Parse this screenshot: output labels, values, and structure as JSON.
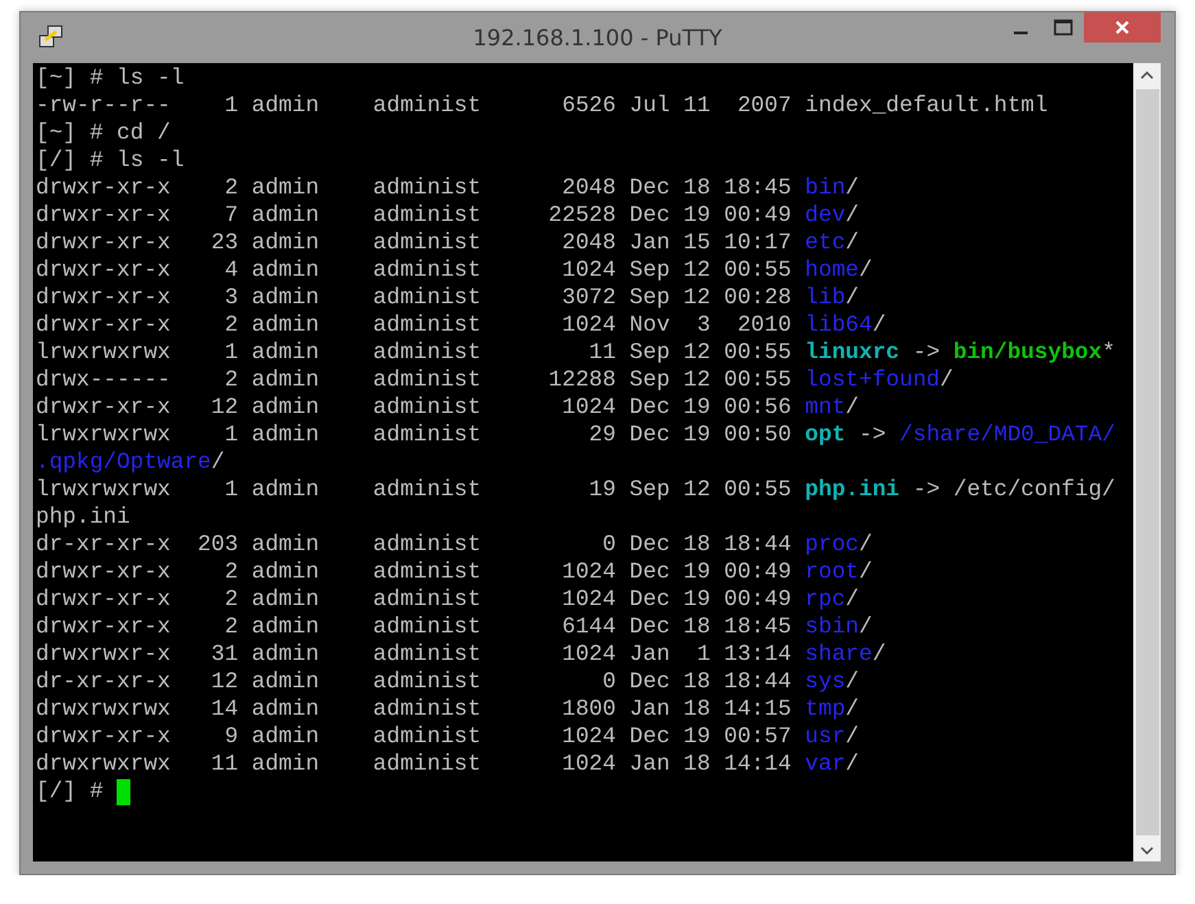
{
  "window": {
    "title": "192.168.1.100 - PuTTY"
  },
  "terminal": {
    "lines": [
      {
        "segments": [
          {
            "text": "[~] # ls -l",
            "kind": "plain"
          }
        ]
      },
      {
        "segments": [
          {
            "text": "-rw-r--r--    1 admin    administ      6526 Jul 11  2007 index_default.html",
            "kind": "plain"
          }
        ]
      },
      {
        "segments": [
          {
            "text": "[~] # cd /",
            "kind": "plain"
          }
        ]
      },
      {
        "segments": [
          {
            "text": "[/] # ls -l",
            "kind": "plain"
          }
        ]
      },
      {
        "segments": [
          {
            "text": "drwxr-xr-x    2 admin    administ      2048 Dec 18 18:45 ",
            "kind": "plain"
          },
          {
            "text": "bin",
            "kind": "dir"
          },
          {
            "text": "/",
            "kind": "plain"
          }
        ]
      },
      {
        "segments": [
          {
            "text": "drwxr-xr-x    7 admin    administ     22528 Dec 19 00:49 ",
            "kind": "plain"
          },
          {
            "text": "dev",
            "kind": "dir"
          },
          {
            "text": "/",
            "kind": "plain"
          }
        ]
      },
      {
        "segments": [
          {
            "text": "drwxr-xr-x   23 admin    administ      2048 Jan 15 10:17 ",
            "kind": "plain"
          },
          {
            "text": "etc",
            "kind": "dir"
          },
          {
            "text": "/",
            "kind": "plain"
          }
        ]
      },
      {
        "segments": [
          {
            "text": "drwxr-xr-x    4 admin    administ      1024 Sep 12 00:55 ",
            "kind": "plain"
          },
          {
            "text": "home",
            "kind": "dir"
          },
          {
            "text": "/",
            "kind": "plain"
          }
        ]
      },
      {
        "segments": [
          {
            "text": "drwxr-xr-x    3 admin    administ      3072 Sep 12 00:28 ",
            "kind": "plain"
          },
          {
            "text": "lib",
            "kind": "dir"
          },
          {
            "text": "/",
            "kind": "plain"
          }
        ]
      },
      {
        "segments": [
          {
            "text": "drwxr-xr-x    2 admin    administ      1024 Nov  3  2010 ",
            "kind": "plain"
          },
          {
            "text": "lib64",
            "kind": "dir"
          },
          {
            "text": "/",
            "kind": "plain"
          }
        ]
      },
      {
        "segments": [
          {
            "text": "lrwxrwxrwx    1 admin    administ        11 Sep 12 00:55 ",
            "kind": "plain"
          },
          {
            "text": "linuxrc",
            "kind": "link"
          },
          {
            "text": " -> ",
            "kind": "plain"
          },
          {
            "text": "bin/busybox",
            "kind": "exec"
          },
          {
            "text": "*",
            "kind": "plain"
          }
        ]
      },
      {
        "segments": [
          {
            "text": "drwx------    2 admin    administ     12288 Sep 12 00:55 ",
            "kind": "plain"
          },
          {
            "text": "lost+found",
            "kind": "dir"
          },
          {
            "text": "/",
            "kind": "plain"
          }
        ]
      },
      {
        "segments": [
          {
            "text": "drwxr-xr-x   12 admin    administ      1024 Dec 19 00:56 ",
            "kind": "plain"
          },
          {
            "text": "mnt",
            "kind": "dir"
          },
          {
            "text": "/",
            "kind": "plain"
          }
        ]
      },
      {
        "segments": [
          {
            "text": "lrwxrwxrwx    1 admin    administ        29 Dec 19 00:50 ",
            "kind": "plain"
          },
          {
            "text": "opt",
            "kind": "link"
          },
          {
            "text": " -> ",
            "kind": "plain"
          },
          {
            "text": "/share/MD0_DATA/",
            "kind": "dir"
          }
        ]
      },
      {
        "segments": [
          {
            "text": ".qpkg/Optware",
            "kind": "dir"
          },
          {
            "text": "/",
            "kind": "plain"
          }
        ]
      },
      {
        "segments": [
          {
            "text": "lrwxrwxrwx    1 admin    administ        19 Sep 12 00:55 ",
            "kind": "plain"
          },
          {
            "text": "php.ini",
            "kind": "link"
          },
          {
            "text": " -> /etc/config/",
            "kind": "plain"
          }
        ]
      },
      {
        "segments": [
          {
            "text": "php.ini",
            "kind": "plain"
          }
        ]
      },
      {
        "segments": [
          {
            "text": "dr-xr-xr-x  203 admin    administ         0 Dec 18 18:44 ",
            "kind": "plain"
          },
          {
            "text": "proc",
            "kind": "dir"
          },
          {
            "text": "/",
            "kind": "plain"
          }
        ]
      },
      {
        "segments": [
          {
            "text": "drwxr-xr-x    2 admin    administ      1024 Dec 19 00:49 ",
            "kind": "plain"
          },
          {
            "text": "root",
            "kind": "dir"
          },
          {
            "text": "/",
            "kind": "plain"
          }
        ]
      },
      {
        "segments": [
          {
            "text": "drwxr-xr-x    2 admin    administ      1024 Dec 19 00:49 ",
            "kind": "plain"
          },
          {
            "text": "rpc",
            "kind": "dir"
          },
          {
            "text": "/",
            "kind": "plain"
          }
        ]
      },
      {
        "segments": [
          {
            "text": "drwxr-xr-x    2 admin    administ      6144 Dec 18 18:45 ",
            "kind": "plain"
          },
          {
            "text": "sbin",
            "kind": "dir"
          },
          {
            "text": "/",
            "kind": "plain"
          }
        ]
      },
      {
        "segments": [
          {
            "text": "drwxrwxr-x   31 admin    administ      1024 Jan  1 13:14 ",
            "kind": "plain"
          },
          {
            "text": "share",
            "kind": "dir"
          },
          {
            "text": "/",
            "kind": "plain"
          }
        ]
      },
      {
        "segments": [
          {
            "text": "dr-xr-xr-x   12 admin    administ         0 Dec 18 18:44 ",
            "kind": "plain"
          },
          {
            "text": "sys",
            "kind": "dir"
          },
          {
            "text": "/",
            "kind": "plain"
          }
        ]
      },
      {
        "segments": [
          {
            "text": "drwxrwxrwx   14 admin    administ      1800 Jan 18 14:15 ",
            "kind": "plain"
          },
          {
            "text": "tmp",
            "kind": "dir"
          },
          {
            "text": "/",
            "kind": "plain"
          }
        ]
      },
      {
        "segments": [
          {
            "text": "drwxr-xr-x    9 admin    administ      1024 Dec 19 00:57 ",
            "kind": "plain"
          },
          {
            "text": "usr",
            "kind": "dir"
          },
          {
            "text": "/",
            "kind": "plain"
          }
        ]
      },
      {
        "segments": [
          {
            "text": "drwxrwxrwx   11 admin    administ      1024 Jan 18 14:14 ",
            "kind": "plain"
          },
          {
            "text": "var",
            "kind": "dir"
          },
          {
            "text": "/",
            "kind": "plain"
          }
        ]
      }
    ],
    "prompt": "[/] # "
  }
}
